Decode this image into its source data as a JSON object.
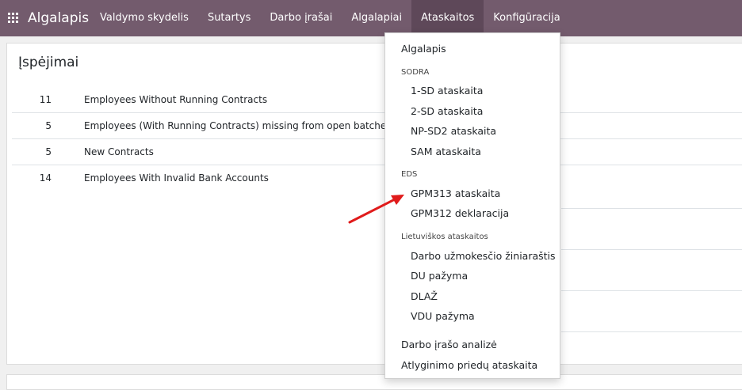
{
  "navbar": {
    "brand": "Algalapis",
    "menu": [
      "Valdymo skydelis",
      "Sutartys",
      "Darbo įrašai",
      "Algalapiai",
      "Ataskaitos",
      "Konfigūracija"
    ],
    "active": "Ataskaitos",
    "bg_color": "#735b6d"
  },
  "panel": {
    "title": "Įspėjimai",
    "rows": [
      {
        "count": "11",
        "label": "Employees Without Running Contracts"
      },
      {
        "count": "5",
        "label": "Employees (With Running Contracts) missing from open batches"
      },
      {
        "count": "5",
        "label": "New Contracts"
      },
      {
        "count": "14",
        "label": "Employees With Invalid Bank Accounts"
      }
    ]
  },
  "dropdown": {
    "top_item": "Algalapis",
    "sodra": {
      "heading": "SODRA",
      "items": [
        "1-SD ataskaita",
        "2-SD ataskaita",
        "NP-SD2 ataskaita",
        "SAM ataskaita"
      ]
    },
    "eds": {
      "heading": "EDS",
      "items": [
        "GPM313 ataskaita",
        "GPM312 deklaracija"
      ]
    },
    "lt": {
      "heading": "Lietuviškos ataskaitos",
      "items": [
        "Darbo užmokesčio žiniaraštis",
        "DU pažyma",
        "DLAŽ",
        "VDU pažyma"
      ]
    },
    "bottom_items": [
      "Darbo įrašo analizė",
      "Atlyginimo priedų ataskaita"
    ]
  },
  "annotation": {
    "arrow_color": "#e01b1b"
  }
}
